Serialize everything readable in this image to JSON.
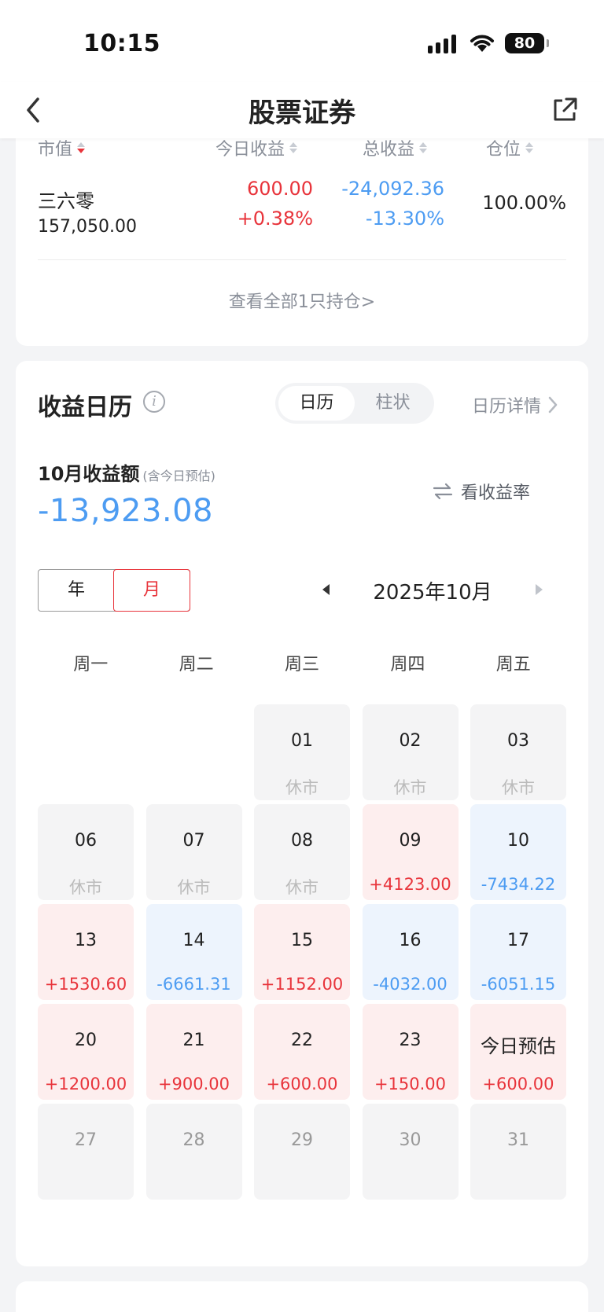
{
  "status": {
    "time": "10:15",
    "battery": "80"
  },
  "nav": {
    "title": "股票证券"
  },
  "holdings": {
    "headers": {
      "market_value": "市值",
      "today": "今日收益",
      "total": "总收益",
      "position": "仓位"
    },
    "row": {
      "name": "三六零",
      "market_value": "157,050.00",
      "today_amount": "600.00",
      "today_pct": "+0.38%",
      "total_amount": "-24,092.36",
      "total_pct": "-13.30%",
      "position": "100.00%"
    },
    "view_all": "查看全部1只持仓>"
  },
  "calendar": {
    "title": "收益日历",
    "info_icon": "info-icon",
    "tabs": [
      "日历",
      "柱状"
    ],
    "active_tab": "日历",
    "detail_link": "日历详情",
    "month_label": "10月收益额",
    "month_note": "(含今日预估)",
    "month_total": "-13,923.08",
    "rate_button": "看收益率",
    "period_toggle": [
      "年",
      "月"
    ],
    "active_period": "月",
    "current_month": "2025年10月",
    "weekdays": [
      "周一",
      "周二",
      "周三",
      "周四",
      "周五"
    ],
    "colors": {
      "gain": "#e8343b",
      "loss": "#4d9cf2",
      "closed": "#f4f4f5"
    },
    "days": [
      {
        "day": "",
        "value": "",
        "type": "empty"
      },
      {
        "day": "",
        "value": "",
        "type": "empty"
      },
      {
        "day": "01",
        "value": "休市",
        "type": "closed"
      },
      {
        "day": "02",
        "value": "休市",
        "type": "closed"
      },
      {
        "day": "03",
        "value": "休市",
        "type": "closed"
      },
      {
        "day": "06",
        "value": "休市",
        "type": "closed"
      },
      {
        "day": "07",
        "value": "休市",
        "type": "closed"
      },
      {
        "day": "08",
        "value": "休市",
        "type": "closed"
      },
      {
        "day": "09",
        "value": "+4123.00",
        "type": "pos"
      },
      {
        "day": "10",
        "value": "-7434.22",
        "type": "neg"
      },
      {
        "day": "13",
        "value": "+1530.60",
        "type": "pos"
      },
      {
        "day": "14",
        "value": "-6661.31",
        "type": "neg"
      },
      {
        "day": "15",
        "value": "+1152.00",
        "type": "pos"
      },
      {
        "day": "16",
        "value": "-4032.00",
        "type": "neg"
      },
      {
        "day": "17",
        "value": "-6051.15",
        "type": "neg"
      },
      {
        "day": "20",
        "value": "+1200.00",
        "type": "pos"
      },
      {
        "day": "21",
        "value": "+900.00",
        "type": "pos"
      },
      {
        "day": "22",
        "value": "+600.00",
        "type": "pos"
      },
      {
        "day": "23",
        "value": "+150.00",
        "type": "pos"
      },
      {
        "day": "今日预估",
        "value": "+600.00",
        "type": "pos today"
      },
      {
        "day": "27",
        "value": "",
        "type": "future"
      },
      {
        "day": "28",
        "value": "",
        "type": "future"
      },
      {
        "day": "29",
        "value": "",
        "type": "future"
      },
      {
        "day": "30",
        "value": "",
        "type": "future"
      },
      {
        "day": "31",
        "value": "",
        "type": "future"
      }
    ]
  }
}
